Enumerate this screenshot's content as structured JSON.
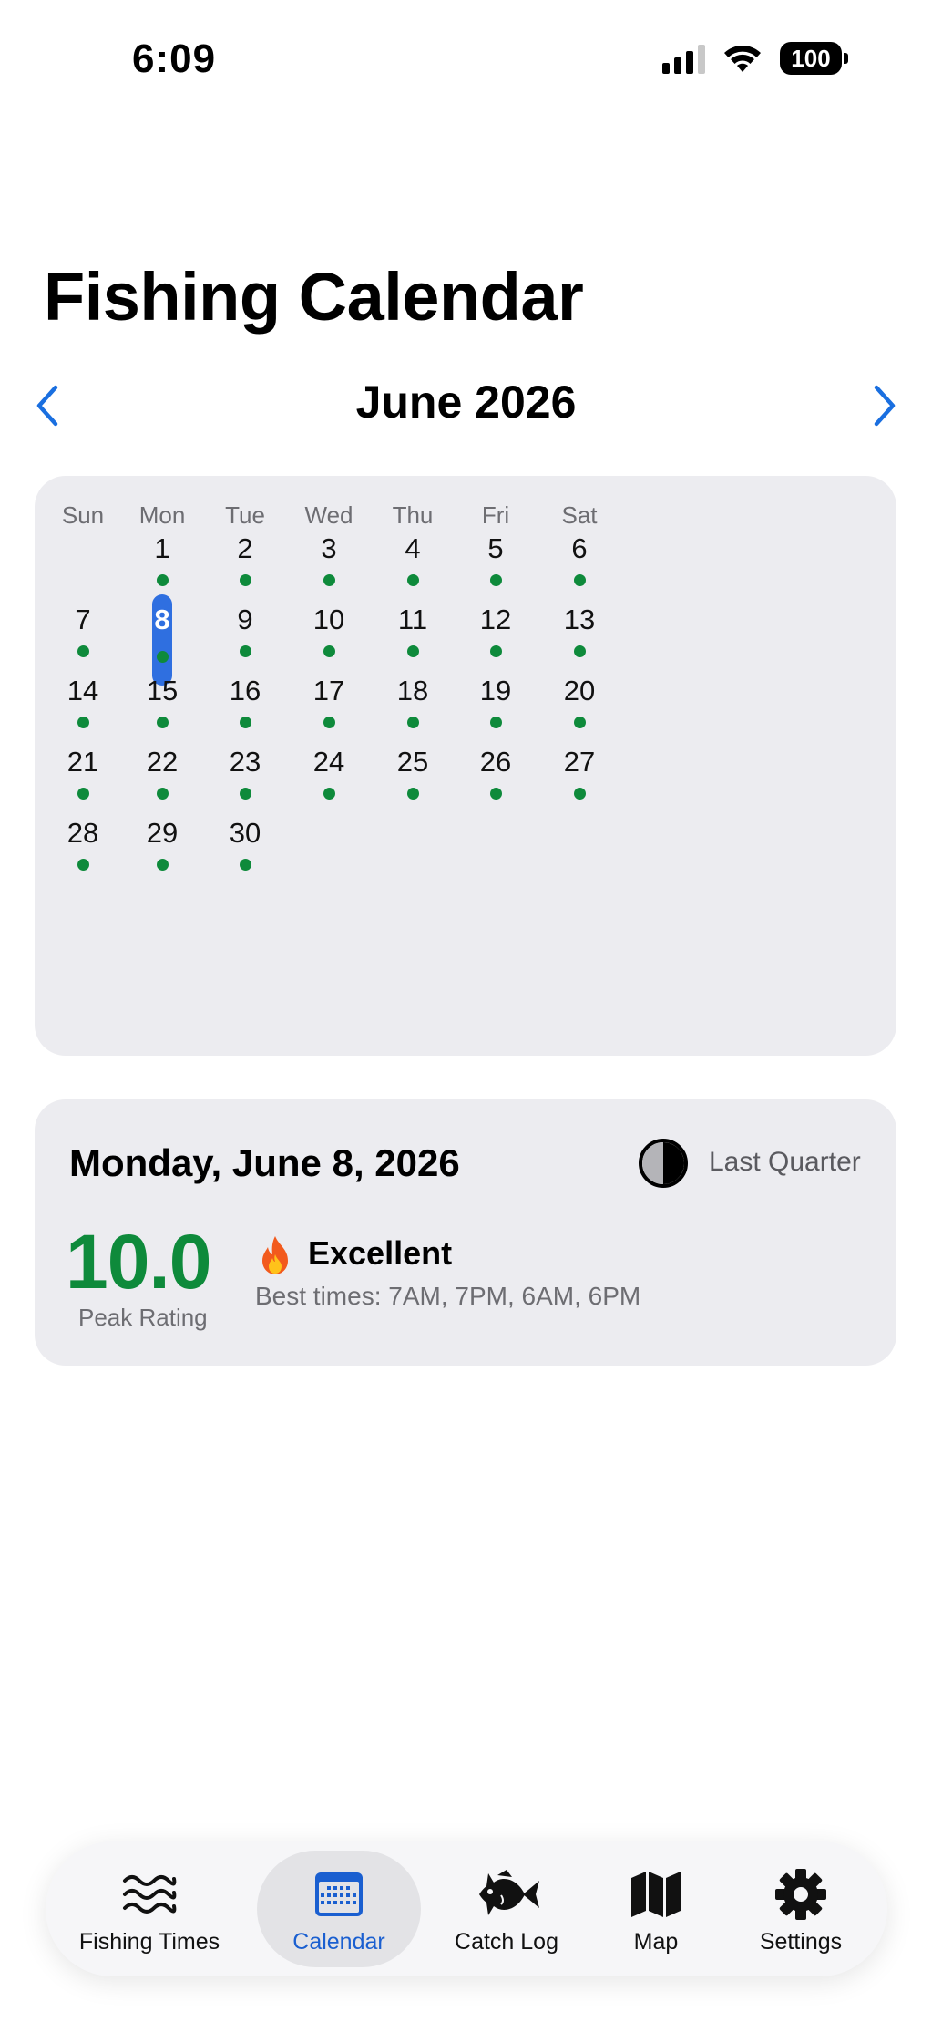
{
  "status_bar": {
    "time": "6:09",
    "battery": "100"
  },
  "page": {
    "title": "Fishing Calendar"
  },
  "month_nav": {
    "title": "June 2026",
    "prev_icon": "chevron-left-icon",
    "next_icon": "chevron-right-icon"
  },
  "calendar": {
    "weekdays": [
      "Sun",
      "Mon",
      "Tue",
      "Wed",
      "Thu",
      "Fri",
      "Sat"
    ],
    "days": [
      "1",
      "2",
      "3",
      "4",
      "5",
      "6",
      "7",
      "8",
      "9",
      "10",
      "11",
      "12",
      "13",
      "14",
      "15",
      "16",
      "17",
      "18",
      "19",
      "20",
      "21",
      "22",
      "23",
      "24",
      "25",
      "26",
      "27",
      "28",
      "29",
      "30"
    ],
    "first_weekday_index": 1,
    "selected_day": "8",
    "dot_color": "#0e8a3b",
    "selected_color": "#2f6fe0"
  },
  "detail": {
    "date": "Monday, June 8, 2026",
    "moon_icon": "last-quarter-moon-icon",
    "moon_phase": "Last Quarter",
    "peak_value": "10.0",
    "peak_label": "Peak Rating",
    "rating_icon": "fire-icon",
    "rating_text": "Excellent",
    "best_times": "Best times: 7AM, 7PM, 6AM, 6PM",
    "rating_color": "#0e8a3b"
  },
  "tabs": [
    {
      "label": "Fishing Times",
      "icon": "waves-icon"
    },
    {
      "label": "Calendar",
      "icon": "calendar-icon",
      "active": true
    },
    {
      "label": "Catch Log",
      "icon": "fish-icon"
    },
    {
      "label": "Map",
      "icon": "map-icon"
    },
    {
      "label": "Settings",
      "icon": "gear-icon"
    }
  ],
  "colors": {
    "accent": "#1a5fd0",
    "card_bg": "#ececf0"
  }
}
